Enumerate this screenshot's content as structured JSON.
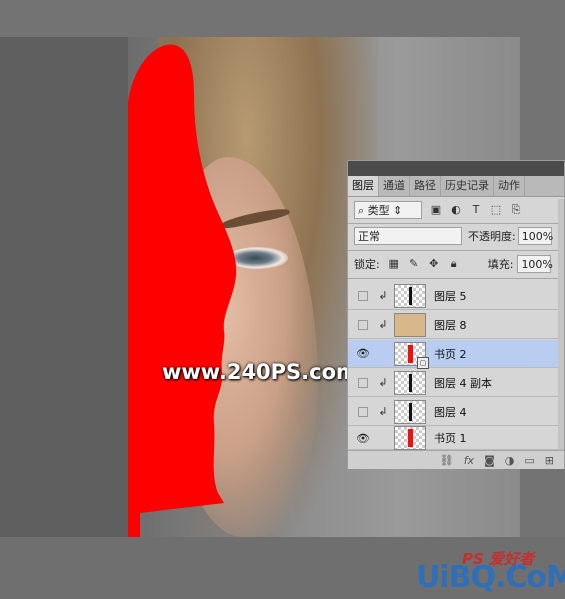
{
  "colors": {
    "red": "#ff0000",
    "selection": "#b8cdef"
  },
  "watermark": "www.240PS.com",
  "panel": {
    "tabs": [
      "图层",
      "通道",
      "路径",
      "历史记录",
      "动作"
    ],
    "kind_label": "类型",
    "blend_mode": "正常",
    "opacity_label": "不透明度:",
    "opacity_value": "100%",
    "lock_label": "锁定:",
    "fill_label": "填充:",
    "fill_value": "100%",
    "layers": [
      {
        "name": "图层 5",
        "visible": false,
        "clipped": true,
        "selected": false
      },
      {
        "name": "图层 8",
        "visible": false,
        "clipped": true,
        "selected": false
      },
      {
        "name": "书页 2",
        "visible": true,
        "clipped": false,
        "selected": true
      },
      {
        "name": "图层 4 副本",
        "visible": false,
        "clipped": true,
        "selected": false
      },
      {
        "name": "图层 4",
        "visible": false,
        "clipped": true,
        "selected": false
      },
      {
        "name": "书页 1",
        "visible": true,
        "clipped": false,
        "selected": false
      }
    ],
    "footer_icons": [
      "link-icon",
      "fx-icon",
      "mask-icon",
      "adjustment-icon",
      "folder-icon",
      "new-layer-icon"
    ]
  },
  "brand": {
    "ps_text": "PS 爱好者",
    "logo": "UiBQ.CoM"
  }
}
